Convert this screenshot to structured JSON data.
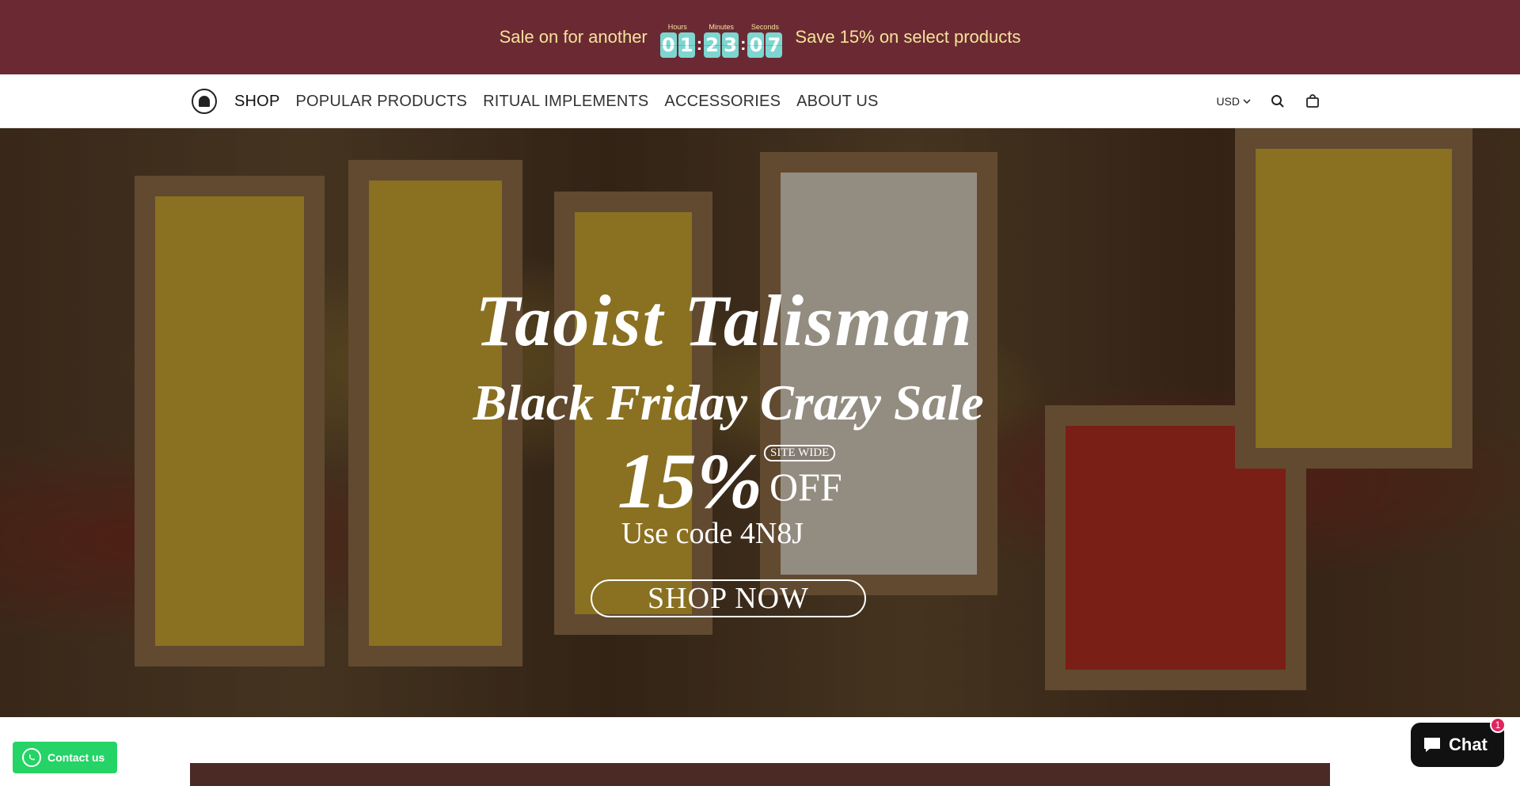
{
  "announcement": {
    "prefix": "Sale on for another",
    "suffix": "Save 15% on select products",
    "timer": {
      "hours_label": "Hours",
      "minutes_label": "Minutes",
      "seconds_label": "Seconds",
      "hours": [
        "0",
        "1"
      ],
      "minutes": [
        "2",
        "3"
      ],
      "seconds": [
        "0",
        "7"
      ]
    },
    "bg_color": "#6b2a33",
    "text_color": "#f4e39a",
    "digit_color": "#7dd6d0"
  },
  "header": {
    "logo_icon": "taoist-logo-icon",
    "nav": [
      {
        "label": "SHOP"
      },
      {
        "label": "POPULAR PRODUCTS"
      },
      {
        "label": "RITUAL IMPLEMENTS"
      },
      {
        "label": "ACCESSORIES"
      },
      {
        "label": "ABOUT US"
      }
    ],
    "currency": "USD",
    "search_icon": "search-icon",
    "cart_icon": "cart-icon"
  },
  "hero": {
    "title": "Taoist Talisman",
    "subtitle": "Black Friday Crazy Sale",
    "percent": "15%",
    "sitewide": "SITE WIDE",
    "off": "OFF",
    "code_text": "Use code 4N8J",
    "cta": "SHOP NOW"
  },
  "widgets": {
    "contact_label": "Contact us",
    "chat_label": "Chat",
    "chat_badge": "1"
  }
}
